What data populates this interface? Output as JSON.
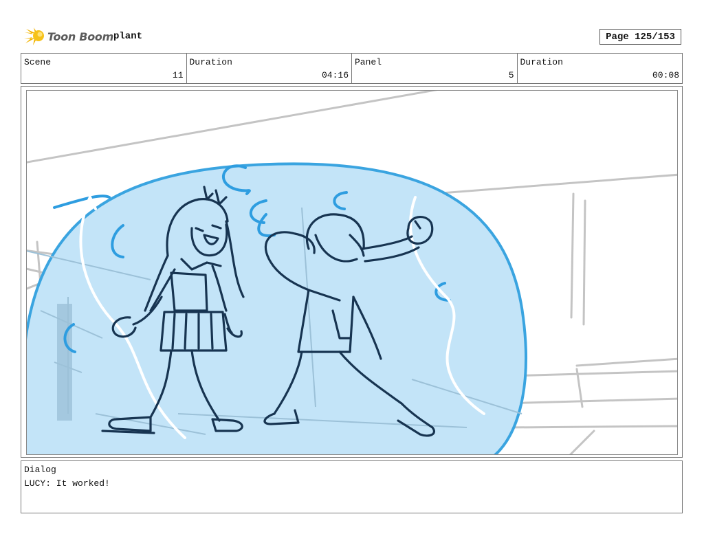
{
  "header": {
    "brand": "Toon Boom",
    "project": "plant",
    "page": "Page 125/153"
  },
  "info": {
    "scene_label": "Scene",
    "scene_value": "11",
    "duration_label": "Duration",
    "duration_value": "04:16",
    "panel_label": "Panel",
    "panel_value": "5",
    "panel_duration_label": "Duration",
    "panel_duration_value": "00:08"
  },
  "panel": {
    "image": "storyboard-sketch",
    "colors": {
      "bubble": "#c3e4f8",
      "bubble_outline": "#3aa4e0",
      "ink": "#173451",
      "background_lines": "#c4c4c4"
    }
  },
  "dialog": {
    "label": "Dialog",
    "text": "LUCY: It worked!"
  }
}
